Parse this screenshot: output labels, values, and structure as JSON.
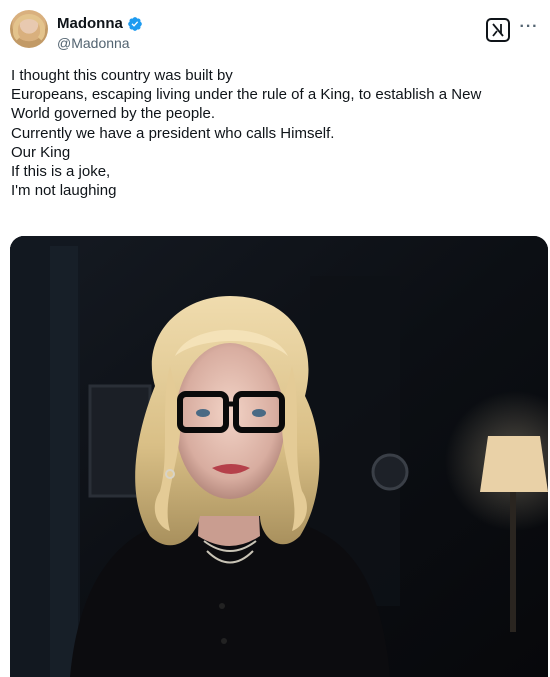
{
  "author": {
    "name": "Madonna",
    "handle": "@Madonna",
    "avatar_icon": "profile-photo",
    "verified_icon": "verified-badge-icon",
    "verified_color": "#1d9bf0"
  },
  "actions": {
    "grok_icon": "grok-icon",
    "more_icon": "more-options-icon",
    "more_label": "···"
  },
  "tweet": {
    "lines": [
      "I thought this country was built by",
      "Europeans, escaping living under the rule of a King, to establish a New",
      "World governed by the people.",
      "Currently we have a president who calls Himself.",
      "Our King",
      "If this is a joke,",
      "I'm not laughing"
    ]
  },
  "media": {
    "type": "photo",
    "subject": "portrait-selfie-photo"
  },
  "colors": {
    "text": "#0f1419",
    "secondary": "#536471",
    "accent": "#1d9bf0"
  }
}
